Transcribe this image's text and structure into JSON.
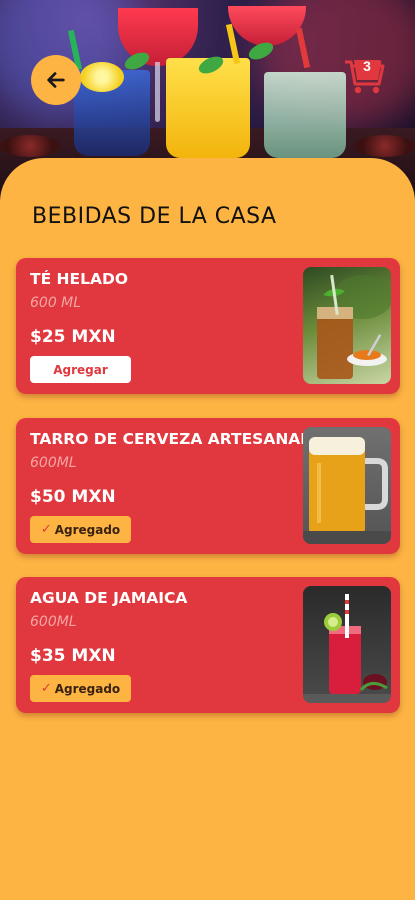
{
  "header": {
    "back_icon": "arrow-left-icon",
    "cart_icon": "shopping-cart-icon",
    "cart_count": "3",
    "accent": "#e0383e",
    "background": "#fdb443"
  },
  "page": {
    "title": "BEBIDAS DE LA CASA"
  },
  "products": [
    {
      "name": "TÉ HELADO",
      "size": "600 ML",
      "price": "$25 MXN",
      "action_label": "Agregar",
      "added": false,
      "image": "iced-tea-photo"
    },
    {
      "name": "TARRO DE CERVEZA ARTESANAL",
      "size": "600ML",
      "price": "$50 MXN",
      "action_label": "Agregado",
      "added": true,
      "image": "beer-mug-photo"
    },
    {
      "name": "AGUA DE JAMAICA",
      "size": "600ML",
      "price": "$35 MXN",
      "action_label": "Agregado",
      "added": true,
      "image": "hibiscus-water-photo"
    }
  ]
}
